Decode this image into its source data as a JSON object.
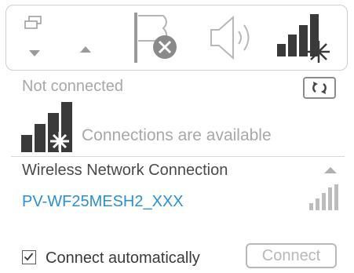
{
  "status": {
    "not_connected": "Not connected",
    "connections_available": "Connections are available"
  },
  "network_section": {
    "title": "Wireless Network Connection"
  },
  "networks": [
    {
      "ssid": "PV-WF25MESH2_XXX",
      "signal_bars": 4
    }
  ],
  "connect_automatically": {
    "label": "Connect automatically",
    "checked": true
  },
  "connect_button": {
    "label": "Connect",
    "enabled": false
  },
  "colors": {
    "network_name": "#2b8fd6",
    "muted_text": "#a8a8a8",
    "icon_dark": "#3a3a3a"
  },
  "icons": [
    "show-windows-icon",
    "chevron-down-icon",
    "chevron-up-icon",
    "action-center-flag-icon",
    "speaker-icon",
    "wifi-signal-icon",
    "refresh-icon",
    "collapse-icon"
  ]
}
